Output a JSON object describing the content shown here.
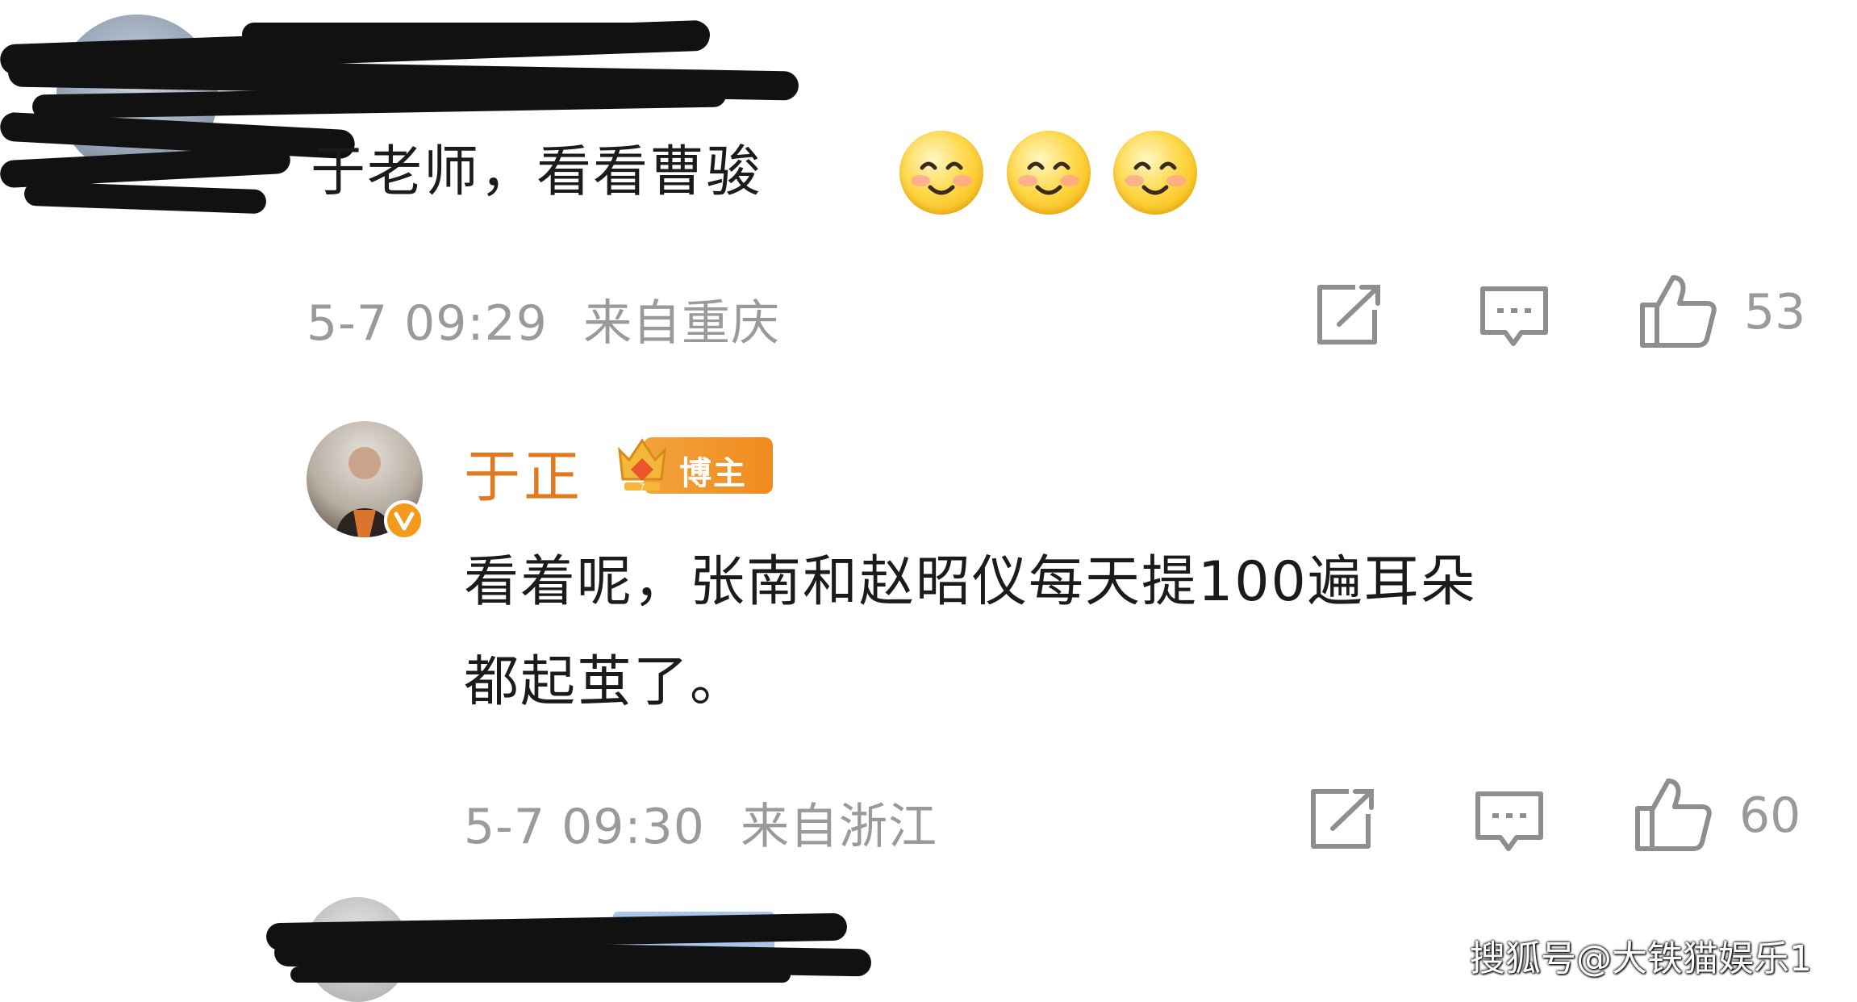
{
  "comment1": {
    "text": "于老师，看看曹骏",
    "emoji_count": 3,
    "emoji_name": "smile-emoji",
    "time": "5-7 09:29",
    "location": "来自重庆",
    "likes": "53",
    "icons": [
      "share-icon",
      "comment-icon",
      "like-icon"
    ]
  },
  "reply": {
    "username": "于正",
    "badge": "博主",
    "verified_icon": "verified-v-icon",
    "text_line1": "看着呢，张南和赵昭仪每天提100遍耳朵",
    "text_line2": "都起茧了。",
    "time": "5-7 09:30",
    "location": "来自浙江",
    "likes": "60",
    "icons": [
      "share-icon",
      "comment-icon",
      "like-icon"
    ]
  },
  "watermark": "搜狐号@大铁猫娱乐1",
  "colors": {
    "username": "#e17a1e",
    "meta_gray": "#9a9a9a",
    "text": "#1b1b1b",
    "badge": "#f08a1e"
  }
}
